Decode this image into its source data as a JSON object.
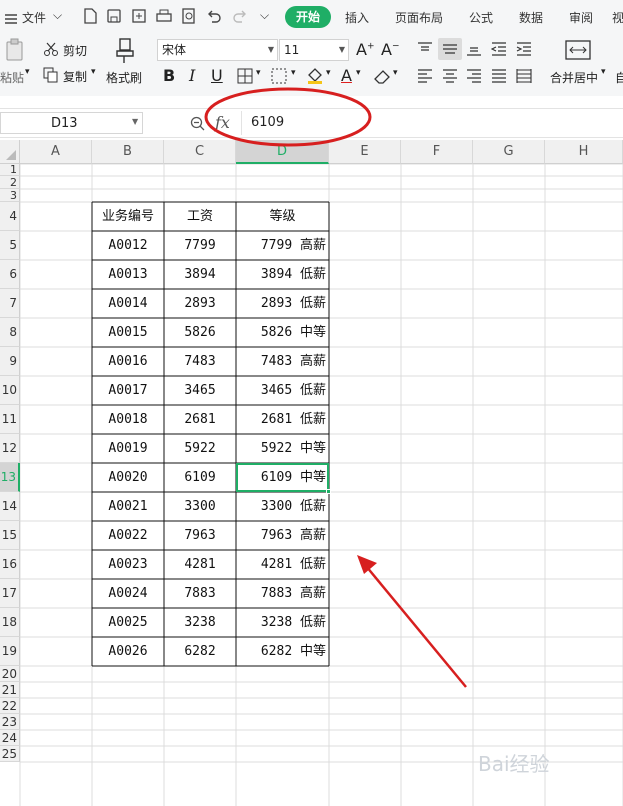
{
  "menubar": {
    "file_label": "文件",
    "tabs": [
      "开始",
      "插入",
      "页面布局",
      "公式",
      "数据",
      "审阅",
      "视"
    ]
  },
  "ribbon": {
    "paste_label": "粘贴",
    "cut_label": "剪切",
    "copy_label": "复制",
    "format_painter_label": "格式刷",
    "font_name": "宋体",
    "font_size": "11",
    "merge_center_label": "合并居中",
    "auto_label": "自"
  },
  "formula_bar": {
    "name_box": "D13",
    "fx_label": "fx",
    "formula_value": "6109"
  },
  "sheet": {
    "columns": [
      "A",
      "B",
      "C",
      "D",
      "E",
      "F",
      "G",
      "H"
    ],
    "rows": [
      "1",
      "2",
      "3",
      "4",
      "5",
      "6",
      "7",
      "8",
      "9",
      "10",
      "11",
      "12",
      "13",
      "14",
      "15",
      "16",
      "17",
      "18",
      "19",
      "20",
      "21",
      "22",
      "23",
      "24",
      "25"
    ],
    "active_cell": "D13",
    "header_row": [
      "业务编号",
      "工资",
      "等级"
    ],
    "records": [
      [
        "A0012",
        "7799",
        "7799",
        "高薪"
      ],
      [
        "A0013",
        "3894",
        "3894",
        "低薪"
      ],
      [
        "A0014",
        "2893",
        "2893",
        "低薪"
      ],
      [
        "A0015",
        "5826",
        "5826",
        "中等"
      ],
      [
        "A0016",
        "7483",
        "7483",
        "高薪"
      ],
      [
        "A0017",
        "3465",
        "3465",
        "低薪"
      ],
      [
        "A0018",
        "2681",
        "2681",
        "低薪"
      ],
      [
        "A0019",
        "5922",
        "5922",
        "中等"
      ],
      [
        "A0020",
        "6109",
        "6109",
        "中等"
      ],
      [
        "A0021",
        "3300",
        "3300",
        "低薪"
      ],
      [
        "A0022",
        "7963",
        "7963",
        "高薪"
      ],
      [
        "A0023",
        "4281",
        "4281",
        "低薪"
      ],
      [
        "A0024",
        "7883",
        "7883",
        "高薪"
      ],
      [
        "A0025",
        "3238",
        "3238",
        "低薪"
      ],
      [
        "A0026",
        "6282",
        "6282",
        "中等"
      ]
    ]
  },
  "annotations": {
    "ellipse_color": "#d71f1f",
    "arrow_color": "#d71f1f"
  },
  "watermark": "Bai经验"
}
